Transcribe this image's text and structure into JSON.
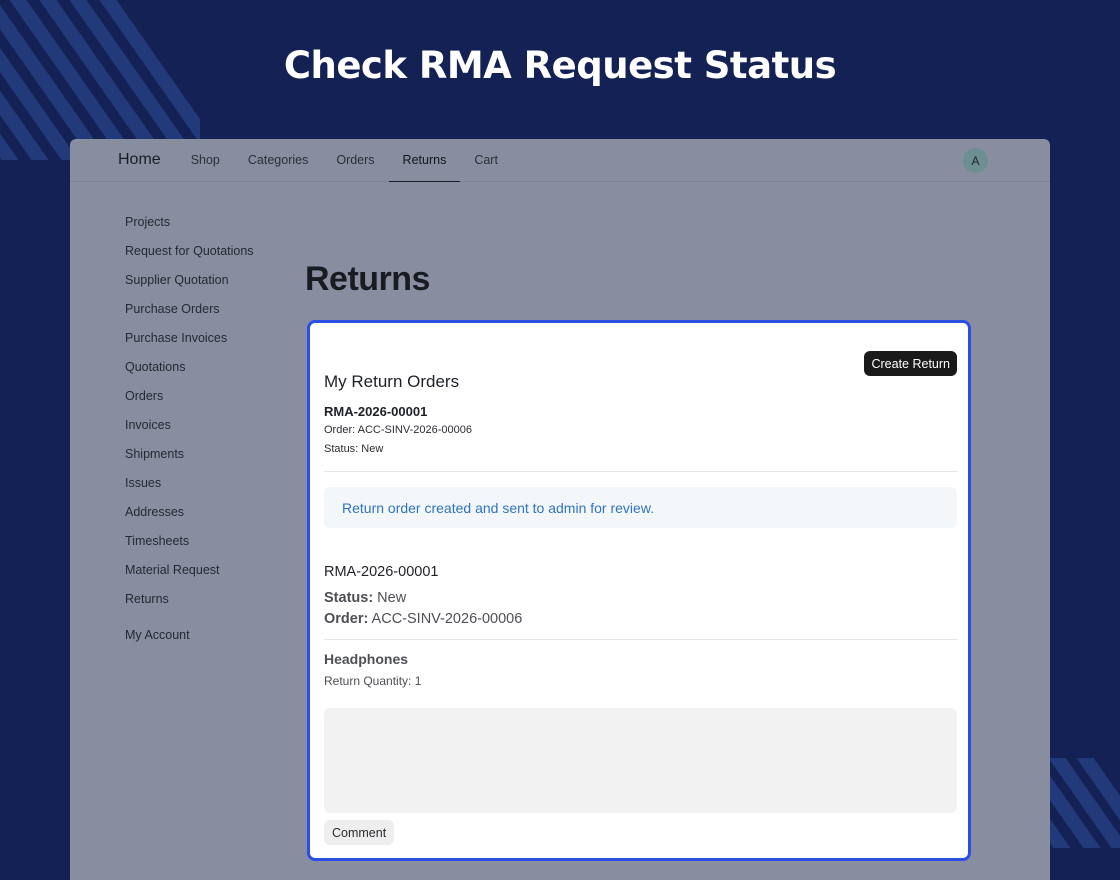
{
  "heading": "Check RMA Request Status",
  "navbar": {
    "brand": "Home",
    "links": [
      "Shop",
      "Categories",
      "Orders",
      "Returns",
      "Cart"
    ],
    "active": "Returns",
    "avatar_initial": "A"
  },
  "sidebar": {
    "items": [
      "Projects",
      "Request for Quotations",
      "Supplier Quotation",
      "Purchase Orders",
      "Purchase Invoices",
      "Quotations",
      "Orders",
      "Invoices",
      "Shipments",
      "Issues",
      "Addresses",
      "Timesheets",
      "Material Request",
      "Returns"
    ],
    "account": "My Account"
  },
  "main": {
    "title": "Returns",
    "create_button": "Create Return",
    "section_title": "My Return Orders",
    "list_item": {
      "id": "RMA-2026-00001",
      "order_line": "Order: ACC-SINV-2026-00006",
      "status_line": "Status: New"
    },
    "info_message": "Return order created and sent to admin for review.",
    "detail": {
      "id": "RMA-2026-00001",
      "status_label": "Status:",
      "status_value": " New",
      "order_label": "Order:",
      "order_value": " ACC-SINV-2026-00006",
      "item_name": "Headphones",
      "return_quantity": "Return Quantity: 1"
    },
    "comment_placeholder": "",
    "comment_button": "Comment"
  },
  "colors": {
    "background": "#132154",
    "card_border": "#2b4ee5",
    "info_text": "#2e73c2"
  }
}
